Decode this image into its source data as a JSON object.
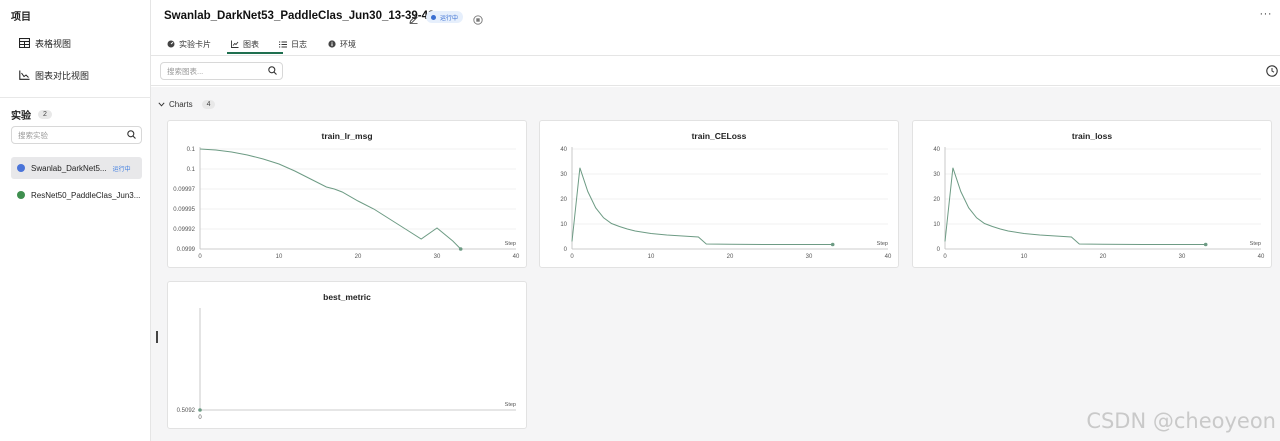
{
  "sidebar": {
    "project_label": "项目",
    "nav": [
      {
        "label": "表格视图",
        "icon": "table-icon"
      },
      {
        "label": "图表对比视图",
        "icon": "chart-compare-icon"
      }
    ],
    "experiments_label": "实验",
    "experiments_count": "2",
    "search_placeholder": "搜索实验",
    "experiments": [
      {
        "name": "Swanlab_DarkNet5...",
        "color": "#4a74d9",
        "badge": "运行中",
        "active": true
      },
      {
        "name": "ResNet50_PaddleClas_Jun3...",
        "color": "#3f8f4f",
        "badge": "",
        "active": false
      }
    ]
  },
  "header": {
    "title": "Swanlab_DarkNet53_PaddleClas_Jun30_13-39-42",
    "status": "运行中",
    "more": "···",
    "tabs": [
      {
        "label": "实验卡片",
        "icon": "dashboard-icon",
        "active": false
      },
      {
        "label": "图表",
        "icon": "line-chart-icon",
        "active": true
      },
      {
        "label": "日志",
        "icon": "list-icon",
        "active": false
      },
      {
        "label": "环境",
        "icon": "info-icon",
        "active": false
      }
    ]
  },
  "toolbar": {
    "search_placeholder": "搜索图表..."
  },
  "charts_group": {
    "label": "Charts",
    "count": "4"
  },
  "colors": {
    "line": "#6d9b84",
    "accent": "#1f6f4f",
    "status": "#3b6fd1"
  },
  "watermark": "CSDN @cheoyeon",
  "chart_data": [
    {
      "type": "line",
      "title": "train_lr_msg",
      "xlabel": "Step",
      "ylabel": "",
      "xlim": [
        0,
        40
      ],
      "ylim": [
        0.0999,
        0.1
      ],
      "x_ticks": [
        "0",
        "10",
        "20",
        "30",
        "40"
      ],
      "y_ticks": [
        "0.1",
        "0.1",
        "0.09997",
        "0.09995",
        "0.09992",
        "0.0999"
      ],
      "series": [
        {
          "x": [
            0,
            2,
            4,
            6,
            8,
            10,
            12,
            14,
            16,
            17,
            18,
            20,
            22,
            24,
            26,
            28,
            30,
            32,
            33
          ],
          "y": [
            0.1,
            0.099999,
            0.099997,
            0.099994,
            0.09999,
            0.099985,
            0.099978,
            0.09997,
            0.099962,
            0.09996,
            0.099957,
            0.099948,
            0.09994,
            0.09993,
            0.09992,
            0.09991,
            0.099921,
            0.099908,
            0.0999
          ]
        }
      ]
    },
    {
      "type": "line",
      "title": "train_CELoss",
      "xlabel": "Step",
      "ylabel": "",
      "xlim": [
        0,
        40
      ],
      "ylim": [
        0,
        40
      ],
      "x_ticks": [
        "0",
        "10",
        "20",
        "30",
        "40"
      ],
      "y_ticks": [
        "40",
        "30",
        "20",
        "10",
        "0"
      ],
      "series": [
        {
          "x": [
            0,
            1,
            2,
            3,
            4,
            5,
            6,
            7,
            8,
            10,
            12,
            14,
            16,
            17,
            20,
            25,
            30,
            33
          ],
          "y": [
            3,
            32.5,
            23,
            16.5,
            12.5,
            10.2,
            9,
            8,
            7.2,
            6.2,
            5.6,
            5.2,
            4.8,
            2,
            1.9,
            1.8,
            1.8,
            1.8
          ]
        }
      ]
    },
    {
      "type": "line",
      "title": "train_loss",
      "xlabel": "Step",
      "ylabel": "",
      "xlim": [
        0,
        40
      ],
      "ylim": [
        0,
        40
      ],
      "x_ticks": [
        "0",
        "10",
        "20",
        "30",
        "40"
      ],
      "y_ticks": [
        "40",
        "30",
        "20",
        "10",
        "0"
      ],
      "series": [
        {
          "x": [
            0,
            1,
            2,
            3,
            4,
            5,
            6,
            7,
            8,
            10,
            12,
            14,
            16,
            17,
            20,
            25,
            30,
            33
          ],
          "y": [
            3,
            32.5,
            23,
            16.5,
            12.5,
            10.2,
            9,
            8,
            7.2,
            6.2,
            5.6,
            5.2,
            4.8,
            2,
            1.9,
            1.8,
            1.8,
            1.8
          ]
        }
      ]
    },
    {
      "type": "line",
      "title": "best_metric",
      "xlabel": "Step",
      "ylabel": "",
      "xlim": [
        0,
        0
      ],
      "ylim": [
        0.5092,
        0.5092
      ],
      "x_ticks": [
        "0"
      ],
      "y_ticks": [
        "0.5092"
      ],
      "series": [
        {
          "x": [
            0
          ],
          "y": [
            0.5092
          ]
        }
      ]
    }
  ]
}
